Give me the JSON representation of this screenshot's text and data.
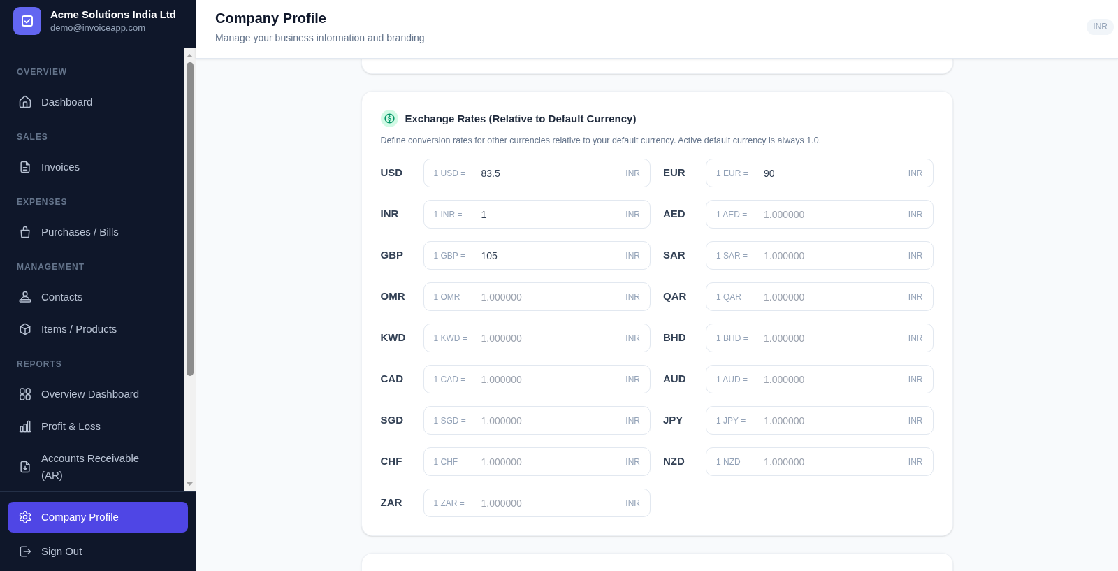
{
  "sidebar": {
    "company": {
      "name": "Acme Solutions India Ltd",
      "email": "demo@invoiceapp.com"
    },
    "sections": [
      {
        "heading": "OVERVIEW",
        "items": [
          {
            "label": "Dashboard",
            "selected": false
          }
        ]
      },
      {
        "heading": "SALES",
        "items": [
          {
            "label": "Invoices",
            "selected": false
          }
        ]
      },
      {
        "heading": "EXPENSES",
        "items": [
          {
            "label": "Purchases / Bills",
            "selected": false
          }
        ]
      },
      {
        "heading": "MANAGEMENT",
        "items": [
          {
            "label": "Contacts",
            "selected": false
          },
          {
            "label": "Items / Products",
            "selected": false
          }
        ]
      },
      {
        "heading": "REPORTS",
        "items": [
          {
            "label": "Overview Dashboard",
            "selected": false
          },
          {
            "label": "Profit & Loss",
            "selected": false
          },
          {
            "label": "Accounts Receivable (AR)",
            "selected": false
          }
        ]
      }
    ],
    "footer_items": [
      {
        "label": "Company Profile",
        "selected": true
      },
      {
        "label": "Sign Out",
        "selected": false
      }
    ]
  },
  "header": {
    "title": "Company Profile",
    "subtitle": "Manage your business information and branding",
    "currency_badge": "INR"
  },
  "exchange_rates": {
    "title": "Exchange Rates (Relative to Default Currency)",
    "description": "Define conversion rates for other currencies relative to your default currency. Active default currency is always 1.0.",
    "rates": [
      {
        "currency": "USD",
        "prefix": "1 USD =",
        "value": "83.5",
        "suffix": "INR"
      },
      {
        "currency": "EUR",
        "prefix": "1 EUR =",
        "value": "90",
        "suffix": "INR"
      },
      {
        "currency": "INR",
        "prefix": "1 INR =",
        "value": "1",
        "suffix": "INR"
      },
      {
        "currency": "AED",
        "prefix": "1 AED =",
        "placeholder": "1.000000",
        "suffix": "INR"
      },
      {
        "currency": "GBP",
        "prefix": "1 GBP =",
        "value": "105",
        "suffix": "INR"
      },
      {
        "currency": "SAR",
        "prefix": "1 SAR =",
        "placeholder": "1.000000",
        "suffix": "INR"
      },
      {
        "currency": "OMR",
        "prefix": "1 OMR =",
        "placeholder": "1.000000",
        "suffix": "INR"
      },
      {
        "currency": "QAR",
        "prefix": "1 QAR =",
        "placeholder": "1.000000",
        "suffix": "INR"
      },
      {
        "currency": "KWD",
        "prefix": "1 KWD =",
        "placeholder": "1.000000",
        "suffix": "INR"
      },
      {
        "currency": "BHD",
        "prefix": "1 BHD =",
        "placeholder": "1.000000",
        "suffix": "INR"
      },
      {
        "currency": "CAD",
        "prefix": "1 CAD =",
        "placeholder": "1.000000",
        "suffix": "INR"
      },
      {
        "currency": "AUD",
        "prefix": "1 AUD =",
        "placeholder": "1.000000",
        "suffix": "INR"
      },
      {
        "currency": "SGD",
        "prefix": "1 SGD =",
        "placeholder": "1.000000",
        "suffix": "INR"
      },
      {
        "currency": "JPY",
        "prefix": "1 JPY =",
        "placeholder": "1.000000",
        "suffix": "INR"
      },
      {
        "currency": "CHF",
        "prefix": "1 CHF =",
        "placeholder": "1.000000",
        "suffix": "INR"
      },
      {
        "currency": "NZD",
        "prefix": "1 NZD =",
        "placeholder": "1.000000",
        "suffix": "INR"
      },
      {
        "currency": "ZAR",
        "prefix": "1 ZAR =",
        "placeholder": "1.000000",
        "suffix": "INR"
      }
    ]
  }
}
